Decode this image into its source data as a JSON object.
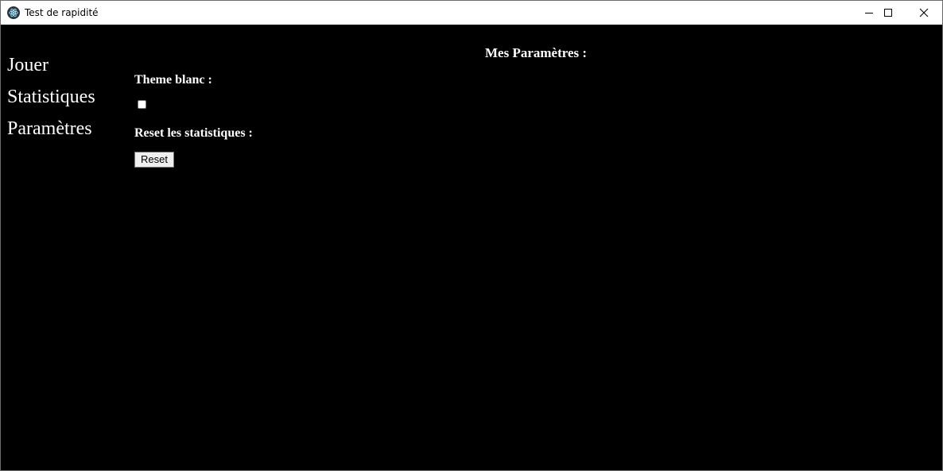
{
  "window": {
    "title": "Test de rapidité",
    "icon": "electron-app-icon"
  },
  "nav": {
    "items": [
      {
        "label": "Jouer"
      },
      {
        "label": "Statistiques"
      },
      {
        "label": "Paramètres"
      }
    ]
  },
  "settings": {
    "title": "Mes Paramètres :",
    "theme_label": "Theme blanc :",
    "theme_checked": false,
    "reset_label": "Reset les statistiques :",
    "reset_button": "Reset"
  },
  "colors": {
    "background": "#000000",
    "text": "#ffffff",
    "titlebar": "#ffffff"
  }
}
